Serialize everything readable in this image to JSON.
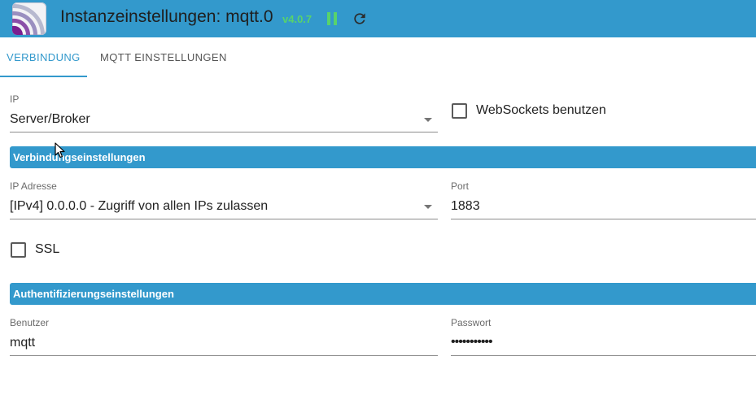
{
  "header": {
    "title": "Instanzeinstellungen: mqtt.0",
    "version": "v4.0.7",
    "colors": {
      "bar": "#3399cc",
      "version": "#58d36b",
      "pause": "#58d36b"
    },
    "icons": {
      "app": "mqtt-logo-icon",
      "pause": "pause-icon",
      "restart": "restart-icon"
    }
  },
  "tabs": [
    {
      "label": "Verbindung",
      "active": true
    },
    {
      "label": "MQTT Einstellungen",
      "active": false
    }
  ],
  "connection": {
    "ip_label": "IP",
    "ip_value": "Server/Broker",
    "websockets_label": "WebSockets benutzen",
    "websockets_checked": false
  },
  "sections": {
    "connection_settings": "Verbindungseinstellungen",
    "auth_settings": "Authentifizierungseinstellungen"
  },
  "connection_settings": {
    "ip_address_label": "IP Adresse",
    "ip_address_value": "[IPv4] 0.0.0.0 - Zugriff von allen IPs zulassen",
    "port_label": "Port",
    "port_value": "1883",
    "ssl_label": "SSL",
    "ssl_checked": false
  },
  "auth": {
    "user_label": "Benutzer",
    "user_value": "mqtt",
    "password_label": "Passwort",
    "password_value": "•••••••••••"
  }
}
